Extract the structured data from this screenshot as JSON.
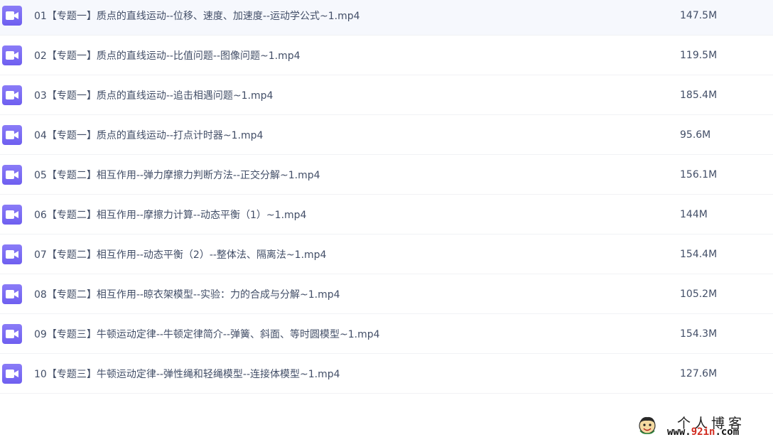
{
  "files": [
    {
      "name": "01【专题一】质点的直线运动--位移、速度、加速度--运动学公式~1.mp4",
      "size": "147.5M",
      "icon": "video-icon"
    },
    {
      "name": "02【专题一】质点的直线运动--比值问题--图像问题~1.mp4",
      "size": "119.5M",
      "icon": "video-icon"
    },
    {
      "name": "03【专题一】质点的直线运动--追击相遇问题~1.mp4",
      "size": "185.4M",
      "icon": "video-icon"
    },
    {
      "name": "04【专题一】质点的直线运动--打点计时器~1.mp4",
      "size": "95.6M",
      "icon": "video-icon"
    },
    {
      "name": "05【专题二】相互作用--弹力摩擦力判断方法--正交分解~1.mp4",
      "size": "156.1M",
      "icon": "video-icon"
    },
    {
      "name": "06【专题二】相互作用--摩擦力计算--动态平衡（1）~1.mp4",
      "size": "144M",
      "icon": "video-icon"
    },
    {
      "name": "07【专题二】相互作用--动态平衡（2）--整体法、隔离法~1.mp4",
      "size": "154.4M",
      "icon": "video-icon"
    },
    {
      "name": "08【专题二】相互作用--晾衣架模型--实验：力的合成与分解~1.mp4",
      "size": "105.2M",
      "icon": "video-icon"
    },
    {
      "name": "09【专题三】牛顿运动定律--牛顿定律简介--弹簧、斜面、等时圆模型~1.mp4",
      "size": "154.3M",
      "icon": "video-icon"
    },
    {
      "name": "10【专题三】牛顿运动定律--弹性绳和轻绳模型--连接体模型~1.mp4",
      "size": "127.6M",
      "icon": "video-icon"
    }
  ],
  "watermark": {
    "title": "个人博客",
    "url_prefix": "www.",
    "url_accent": "92in",
    "url_suffix": ".com"
  },
  "colors": {
    "icon": "#7c6ef5",
    "text": "#424e67",
    "divider": "#f1f2f5",
    "watermark_accent": "#d12a1e"
  }
}
